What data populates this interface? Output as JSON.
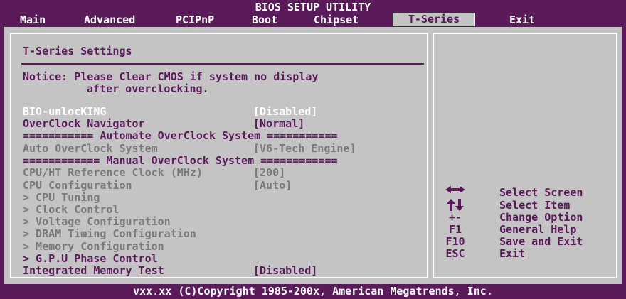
{
  "header": {
    "bios_title": "BIOS SETUP UTILITY",
    "tabs": [
      "Main",
      "Advanced",
      "PCIPnP",
      "Boot",
      "Chipset",
      "T-Series",
      "Exit"
    ],
    "active_tab": "T-Series"
  },
  "panel": {
    "title": "T-Series Settings",
    "notice_line1": "Notice: Please Clear CMOS if system no display",
    "notice_line2": "after overclocking.",
    "items": [
      {
        "label": "BIO-unlocKING",
        "value": "[Disabled]"
      },
      {
        "label": "OverClock Navigator",
        "value": "[Normal]"
      },
      {
        "label": "=========== Automate OverClock System ===========",
        "value": ""
      },
      {
        "label": "Auto OverClock System",
        "value": "[V6-Tech Engine]"
      },
      {
        "label": "============ Manual OverClock System ============",
        "value": ""
      },
      {
        "label": "CPU/HT Reference Clock (MHz)",
        "value": "[200]"
      },
      {
        "label": "CPU Configuration",
        "value": "[Auto]"
      },
      {
        "label": "> CPU Tuning",
        "value": ""
      },
      {
        "label": "> Clock Control",
        "value": ""
      },
      {
        "label": "> Voltage Configuration",
        "value": ""
      },
      {
        "label": "> DRAM Timing Configuration",
        "value": ""
      },
      {
        "label": "> Memory Configuration",
        "value": ""
      },
      {
        "label": "> G.P.U Phase Control",
        "value": ""
      },
      {
        "label": "Integrated Memory Test",
        "value": "[Disabled]"
      }
    ]
  },
  "help": [
    {
      "key": "",
      "icon": "left-right-arrows-icon",
      "text": "Select Screen"
    },
    {
      "key": "",
      "icon": "up-down-arrows-icon",
      "text": "Select Item"
    },
    {
      "key": "+-",
      "text": "Change Option"
    },
    {
      "key": "F1",
      "text": "General Help"
    },
    {
      "key": "F10",
      "text": "Save and Exit"
    },
    {
      "key": "ESC",
      "text": "Exit"
    }
  ],
  "footer": {
    "copyright": "vxx.xx (C)Copyright 1985-200x, American Megatrends, Inc."
  },
  "colors": {
    "frame": "#5b1b5b",
    "panel": "#c4c4c4",
    "disabled_text": "#7a7a7a",
    "highlight_text": "#ffffff"
  }
}
